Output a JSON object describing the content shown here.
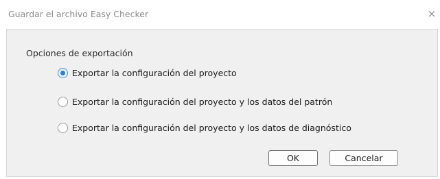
{
  "window": {
    "title": "Guardar el archivo Easy Checker",
    "close_glyph": "×"
  },
  "group": {
    "label": "Opciones de exportación"
  },
  "options": [
    {
      "label": "Exportar la configuración del proyecto",
      "selected": true
    },
    {
      "label": "Exportar la configuración del proyecto y los datos del patrón",
      "selected": false
    },
    {
      "label": "Exportar la configuración del proyecto y los datos de diagnóstico",
      "selected": false
    }
  ],
  "buttons": {
    "ok_label": "OK",
    "cancel_label": "Cancelar"
  },
  "colors": {
    "accent": "#2f7fd3",
    "panel_background": "#f0f0f0"
  }
}
